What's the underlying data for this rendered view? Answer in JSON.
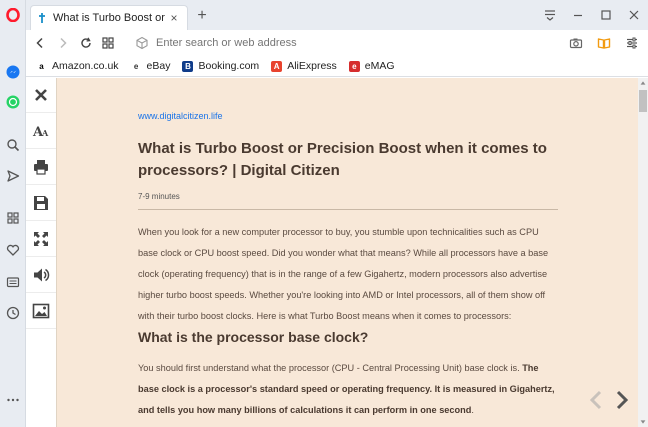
{
  "tab": {
    "title": "What is Turbo Boost or Precis",
    "close": "×"
  },
  "new_tab": "+",
  "address_bar": {
    "placeholder": "Enter search or web address"
  },
  "bookmarks": [
    {
      "label": "Amazon.co.uk",
      "icon": "amazon-icon",
      "glyph": "a",
      "color": "#ffffff",
      "fg": "#000000"
    },
    {
      "label": "eBay",
      "icon": "ebay-icon",
      "glyph": "e",
      "color": "#ffffff",
      "fg": "#333333"
    },
    {
      "label": "Booking.com",
      "icon": "booking-icon",
      "glyph": "B",
      "color": "#0f3c8a",
      "fg": "#ffffff"
    },
    {
      "label": "AliExpress",
      "icon": "aliexpress-icon",
      "glyph": "A",
      "color": "#e8432e",
      "fg": "#ffffff"
    },
    {
      "label": "eMAG",
      "icon": "emag-icon",
      "glyph": "e",
      "color": "#d62d2d",
      "fg": "#ffffff"
    }
  ],
  "article": {
    "source": "www.digitalcitizen.life",
    "title": "What is Turbo Boost or Precision Boost when it comes to processors? | Digital Citizen",
    "reading_time": "7-9 minutes",
    "intro": "When you look for a new computer processor to buy, you stumble upon technicalities such as CPU base clock or CPU boost speed. Did you wonder what that means? While all processors have a base clock (operating frequency) that is in the range of a few Gigahertz, modern processors also advertise higher turbo boost speeds. Whether you're looking into AMD or Intel processors, all of them show off with their turbo boost clocks. Here is what Turbo Boost means when it comes to processors:",
    "section_heading": "What is the processor base clock?",
    "section_para_plain": "You should first understand what the processor (CPU - Central Processing Unit) base clock is. ",
    "section_para_bold": "The base clock is a processor's standard speed or operating frequency. It is measured in Gigahertz, and tells you how many billions of calculations it can perform in one second",
    "section_para_end": "."
  },
  "colors": {
    "reader_bg": "#f8e8d8",
    "link": "#1a73e8",
    "opera_red": "#ff1b2d",
    "accent_orange": "#f29b11"
  }
}
